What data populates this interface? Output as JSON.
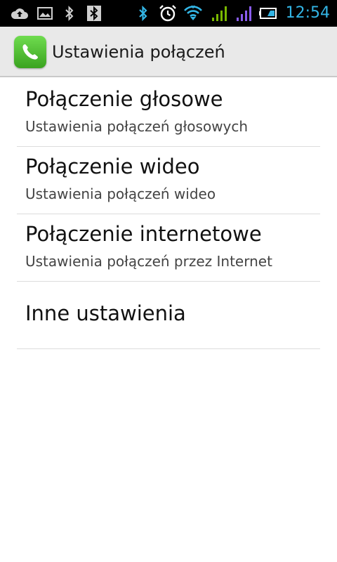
{
  "status_bar": {
    "time": "12:54",
    "icons": [
      "upload-icon",
      "image-icon",
      "bluetooth-icon",
      "bluetooth-box-icon",
      "bluetooth-active-icon",
      "alarm-icon",
      "wifi-icon",
      "signal-green-icon",
      "signal-purple-icon",
      "battery-icon"
    ],
    "accent": "#33b5e5"
  },
  "action_bar": {
    "title": "Ustawienia połączeń",
    "icon": "phone-icon"
  },
  "settings": {
    "items": [
      {
        "title": "Połączenie głosowe",
        "subtitle": "Ustawienia połączeń głosowych"
      },
      {
        "title": "Połączenie wideo",
        "subtitle": "Ustawienia połączeń wideo"
      },
      {
        "title": "Połączenie internetowe",
        "subtitle": "Ustawienia połączeń przez Internet"
      },
      {
        "title": "Inne ustawienia"
      }
    ]
  }
}
